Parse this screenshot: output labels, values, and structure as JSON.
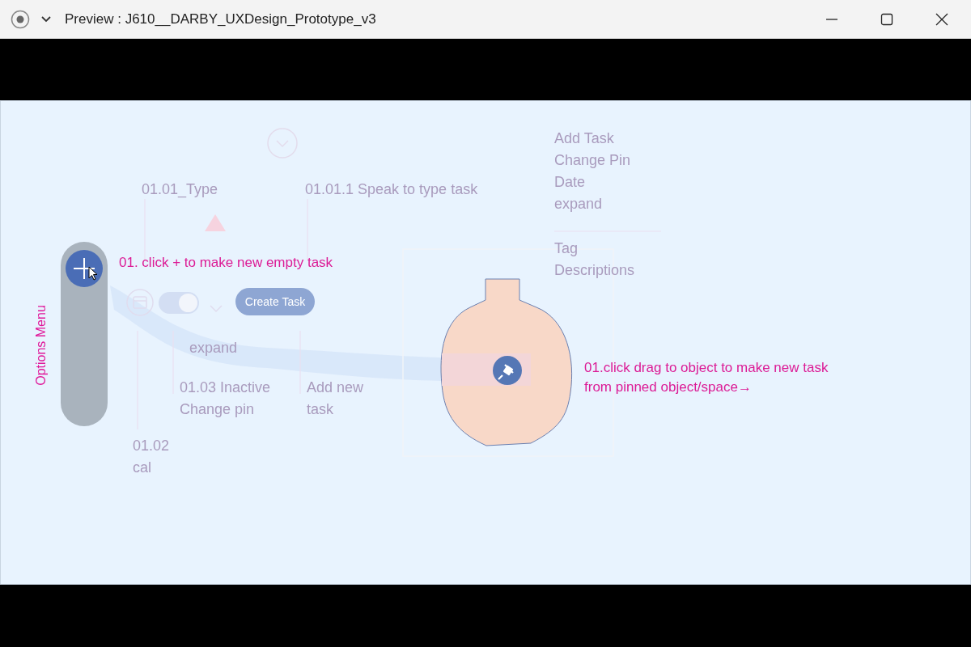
{
  "window": {
    "title": "Preview : J610__DARBY_UXDesign_Prototype_v3"
  },
  "canvas": {
    "faded_labels": [
      {
        "text": "01.01_Type"
      },
      {
        "text": "01.01.1 Speak to type task"
      },
      {
        "text": "expand"
      },
      {
        "text": "01.03 Inactive\nChange pin"
      },
      {
        "text": "Add new\ntask"
      },
      {
        "text": "01.02\ncal"
      }
    ],
    "menu_items": [
      "Add Task",
      "Change Pin",
      "Date",
      "expand"
    ],
    "menu_details": [
      "Tag",
      "Descriptions"
    ],
    "pin_toggle": {
      "on": true
    },
    "create_button": "Create Task",
    "options_menu_label": "Options Menu",
    "callouts": [
      "01. click + to make new empty task",
      "01.click drag to object to make new task from pinned object/space→"
    ]
  }
}
